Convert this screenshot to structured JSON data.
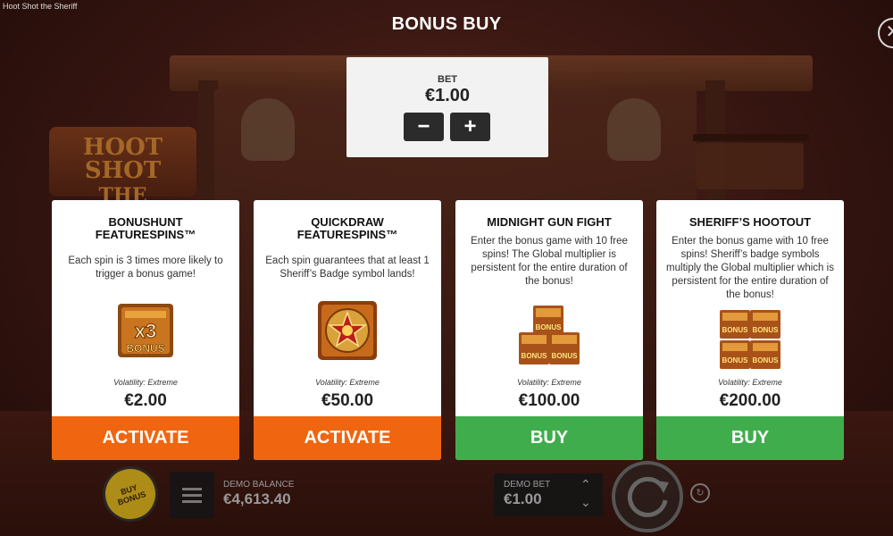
{
  "window_title": "Hoot Shot the Sheriff",
  "header": {
    "title": "BONUS BUY",
    "close_glyph": "✕"
  },
  "background": {
    "logo_line1": "HOOT SHOT",
    "logo_line2": "THE SHERIFF"
  },
  "bet": {
    "label": "BET",
    "value": "€1.00",
    "decrease_glyph": "−",
    "increase_glyph": "+"
  },
  "cards": [
    {
      "title_line1": "BONUSHUNT",
      "title_line2": "FEATURESPINS™",
      "description": "Each spin is 3 times more likely to trigger a bonus game!",
      "icon": "x3-bonus-icon",
      "icon_text_1": "x3",
      "icon_text_2": "BONUS",
      "volatility": "Volatility: Extreme",
      "price": "€2.00",
      "action": "ACTIVATE",
      "action_color": "#f0650f"
    },
    {
      "title_line1": "QUICKDRAW",
      "title_line2": "FEATURESPINS™",
      "description": "Each spin guarantees that at least 1 Sheriff’s Badge symbol lands!",
      "icon": "sheriff-badge-icon",
      "volatility": "Volatility: Extreme",
      "price": "€50.00",
      "action": "ACTIVATE",
      "action_color": "#f0650f"
    },
    {
      "title_line1": "MIDNIGHT GUN FIGHT",
      "title_line2": "",
      "description": "Enter the bonus game with 10 free spins! The Global multiplier is persistent for the entire duration of the bonus!",
      "icon": "bonus-buildings-icon",
      "icon_text": "BONUS",
      "volatility": "Volatility: Extreme",
      "price": "€100.00",
      "action": "BUY",
      "action_color": "#40ad4c"
    },
    {
      "title_line1": "SHERIFF’S HOOTOUT",
      "title_line2": "",
      "description": "Enter the bonus game with 10 free spins! Sheriff’s badge symbols multiply the Global multiplier which is persistent for the entire duration of the bonus!",
      "icon": "bonus-buildings-grid-icon",
      "icon_text": "BONUS",
      "volatility": "Volatility: Extreme",
      "price": "€200.00",
      "action": "BUY",
      "action_color": "#40ad4c"
    }
  ],
  "bottom_bar": {
    "buy_bonus_line1": "BUY",
    "buy_bonus_line2": "BONUS",
    "balance_label": "DEMO BALANCE",
    "balance_value": "€4,613.40",
    "demo_bet_label": "DEMO BET",
    "demo_bet_value": "€1.00",
    "arrow_up": "⌃",
    "arrow_down": "⌄",
    "autoplay_glyph": "↻"
  }
}
